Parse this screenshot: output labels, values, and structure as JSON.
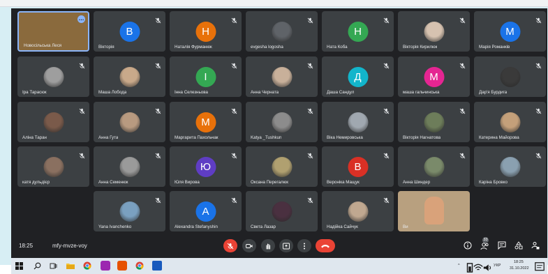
{
  "meeting": {
    "time": "18:25",
    "code": "mfy-mvze-voy",
    "participants_count": "33"
  },
  "colors": {
    "meet_background": "#202124",
    "tile_background": "#3c4043",
    "active_border": "#8ab4f8",
    "end_call": "#ea4335"
  },
  "tiles": [
    {
      "name": "Новосільська Леся",
      "kind": "photo",
      "tone": "#8a6a3d"
    },
    {
      "name": "Вікторія",
      "kind": "letter",
      "letter": "В",
      "color": "#1a73e8"
    },
    {
      "name": "Наталія Фурманюк",
      "kind": "letter",
      "letter": "Н",
      "color": "#e8710a"
    },
    {
      "name": "evgesha logosha",
      "kind": "photo",
      "tone": "#5f6368"
    },
    {
      "name": "Ната Коба",
      "kind": "letter",
      "letter": "Н",
      "color": "#34a853"
    },
    {
      "name": "Вікторія Кирилюк",
      "kind": "photo",
      "tone": "#d6c2b0"
    },
    {
      "name": "Марія Романків",
      "kind": "letter",
      "letter": "М",
      "color": "#1a73e8"
    },
    {
      "name": "Іра Тарасюк",
      "kind": "photo",
      "tone": "#9e9e9e"
    },
    {
      "name": "Маша Лобода",
      "kind": "photo",
      "tone": "#c9a98a"
    },
    {
      "name": "Інна Селезньова",
      "kind": "letter",
      "letter": "І",
      "color": "#34a853"
    },
    {
      "name": "Анна Черната",
      "kind": "photo",
      "tone": "#c8b09a"
    },
    {
      "name": "Даша Сандул",
      "kind": "letter",
      "letter": "Д",
      "color": "#12b5cb"
    },
    {
      "name": "маша гальчинська",
      "kind": "letter",
      "letter": "М",
      "color": "#e52592"
    },
    {
      "name": "Дар'я Бурдига",
      "kind": "photo",
      "tone": "#3a3a3a"
    },
    {
      "name": "Аліна Таран",
      "kind": "photo",
      "tone": "#7a5a4a"
    },
    {
      "name": "Анна Гута",
      "kind": "photo",
      "tone": "#b89a80"
    },
    {
      "name": "Маргарита Пахольчак",
      "kind": "letter",
      "letter": "М",
      "color": "#e8710a"
    },
    {
      "name": "Katya _Tushkun",
      "kind": "photo",
      "tone": "#8c8c8c"
    },
    {
      "name": "Віка Немировська",
      "kind": "photo",
      "tone": "#a0a8b0"
    },
    {
      "name": "Вікторія Нагнатова",
      "kind": "photo",
      "tone": "#6d7d5a"
    },
    {
      "name": "Катерина Майорова",
      "kind": "photo",
      "tone": "#c4a07a"
    },
    {
      "name": "катя дульдієр",
      "kind": "photo",
      "tone": "#8a7060"
    },
    {
      "name": "Анна Семенюк",
      "kind": "photo",
      "tone": "#9a9a9a"
    },
    {
      "name": "Юля Вирова",
      "kind": "letter",
      "letter": "Ю",
      "color": "#5f3dc4"
    },
    {
      "name": "Оксана Перегалюк",
      "kind": "photo",
      "tone": "#b0a070"
    },
    {
      "name": "Вероніка Мащук",
      "kind": "letter",
      "letter": "В",
      "color": "#d93025"
    },
    {
      "name": "Анна Шиндер",
      "kind": "photo",
      "tone": "#7a8a6a"
    },
    {
      "name": "Каріна Бровко",
      "kind": "photo",
      "tone": "#8aa0b0"
    },
    {
      "name": "Yana Ivanchenko",
      "kind": "photo",
      "tone": "#7aa0c0"
    },
    {
      "name": "Alexandra Stefanyshin",
      "kind": "letter",
      "letter": "А",
      "color": "#1a73e8"
    },
    {
      "name": "Света Лазар",
      "kind": "photo",
      "tone": "#4a3040"
    },
    {
      "name": "Надійка Сайчук",
      "kind": "photo",
      "tone": "#c0a890"
    },
    {
      "name": "Ви",
      "kind": "selfcam",
      "tone": "#b8a07f"
    }
  ],
  "taskbar": {
    "language": "УКР",
    "clock_time": "18:25",
    "clock_date": "31.10.2022"
  }
}
